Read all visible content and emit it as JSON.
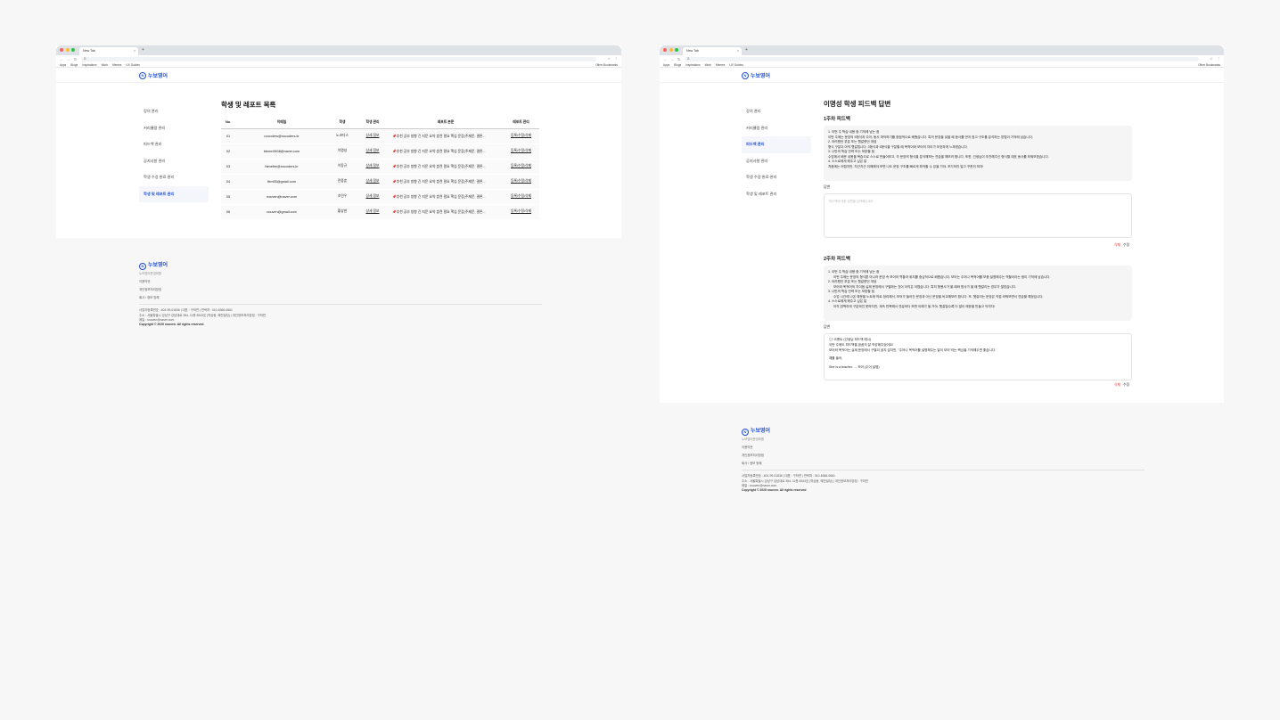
{
  "browser": {
    "tab_title": "New Tab",
    "tab_close": "×",
    "new_tab": "+",
    "omnibox": "G",
    "bookmarks": [
      "Apps",
      "Blogs",
      "Inspirations",
      "Work",
      "Memes",
      "UX Guides"
    ],
    "other_bookmarks": "Other Bookmarks"
  },
  "brand": {
    "logo": "누보영어",
    "logo_mark": "N"
  },
  "sidebar": {
    "items": [
      "강의 관리",
      "커리큘럼 관리",
      "피드백 관리",
      "공지사항 관리",
      "학생 수강 완료 관리",
      "학생 및 레포트 관리"
    ]
  },
  "left_page": {
    "title": "학생 및 레포트 목록",
    "columns": [
      "No.",
      "이메일",
      "학생",
      "학생 관리",
      "레포트 본문",
      "레포트 관리"
    ],
    "rows": [
      {
        "no": "01",
        "email": "nocoders@nocoders.kr",
        "name": "노코더스",
        "manage": "상세 정보",
        "preview": "추천 공부 방향 긴 지문 요약 훈련 필요 핵심 문장(주제문, 결론...",
        "actions": "등록/수정/삭제"
      },
      {
        "no": "02",
        "email": "bbmm9508@naver.com",
        "name": "이명성",
        "manage": "상세 정보",
        "preview": "추천 공부 방향 긴 지문 요약 훈련 필요 핵심 문장(주제문, 결론...",
        "actions": "등록/수정/삭제"
      },
      {
        "no": "03",
        "email": "famelee@nocoders.kr",
        "name": "이동규",
        "manage": "상세 정보",
        "preview": "추천 공부 방향 긴 지문 요약 훈련 필요 핵심 문장(주제문, 결론...",
        "actions": "등록/수정/삭제"
      },
      {
        "no": "04",
        "email": "ffrm55@gmail.com",
        "name": "전중훈",
        "manage": "상세 정보",
        "preview": "추천 공부 방향 긴 지문 요약 훈련 필요 핵심 문장(주제문, 결론...",
        "actions": "등록/수정/삭제"
      },
      {
        "no": "05",
        "email": "nouven@naver.com",
        "name": "조민우",
        "manage": "상세 정보",
        "preview": "추천 공부 방향 긴 지문 요약 훈련 필요 핵심 문장(주제문, 결론...",
        "actions": "등록/수정/삭제"
      },
      {
        "no": "06",
        "email": "nouven@gmail.com",
        "name": "황상현",
        "manage": "상세 정보",
        "preview": "추천 공부 방향 긴 지문 요약 훈련 필요 핵심 문장(주제문, 결론...",
        "actions": "등록/수정/삭제"
      }
    ]
  },
  "right_page": {
    "title": "이명성 학생 피드백 답변",
    "week1": {
      "title": "1주차 피드백",
      "lines": [
        "1. 이번 주 학습 내용 중 기억에 남는 점",
        "이번 주에는 문장의 5형식과 주어, 동사 파악하기를 중점적으로 배웠습니다. 특히 문장을 읽을 때 동사를 먼저 찾고 구조를 분석하는 방법이 기억에 남습니다.",
        "2. 어려웠던 부분 또는 헷갈렸던 개념",
        "형식 구분이 아직 헷갈립니다. 3형식과 5형식을 구분할 때 목적어와 보어의 차이가 모호하게 느껴졌습니다.",
        "3. 나만의 학습 전략 또는 보완할 점",
        "수업에서 배운 내용을 복습으로 스스로 만들어보고, 각 문장의 형식을 분석해보는 연습을 해보려 합니다. 또한, 선생님이 추천해주신 형식별 대표 동사를 외워보겠습니다.",
        "4. 스스로에게 해주고 싶은 말",
        "처음에는 어렵지만, 차근차근 이해해야 보면 나도 문장 구조를 빠르게 파악할 수 있을 거야. 포기하지 말고 꾸준히 하자!"
      ],
      "answer_label": "답변",
      "answer_placeholder": "피드백에 대한 답변을 입력해주세요",
      "delete": "삭제",
      "edit": "수정"
    },
    "week2": {
      "title": "2주차 피드백",
      "lines": [
        "1. 이번 주 학습 내용 중 기억에 남는 점",
        "이번 주에는 문장의 형식뿐 아니라 문장 속 보어의 역할과 위치를 중심적으로 배웠습니다. 보어는 주어나 목적어를 보충 설명해주는 역할이라는 점이 기억에 남습니다.",
        "2. 어려웠던 부분 또는 헷갈렸던 개념",
        "보어와 목적어의 차이점 실제 문장에서 구별하는 것이 아직은 어렵습니다. 특히 형용사가 올 때와 명사가 올 때 헷갈리는 경우가 많았습니다.",
        "3. 나만의 학습 전략 또는 보완할 점",
        "수업 시간에 나온 예문을 노트에 따로 정리해서, 보어가 들어간 문장과 아닌 문장을 비교해보려 합니다. 또, 헷갈리는 문장은 직접 바꿔보면서 연습할 예정입니다.",
        "4. 스스로에게 해주고 싶은 말",
        "아직 완벽하게 구분하진 못하지만, 계속 반복해서 연습하다 보면 이해가 될 거야. 헷갈릴수록 더 많이 예문을 만들고 익히자!"
      ],
      "answer_label": "답변",
      "answer_lines": [
        "💬 코멘트 (선생님 피드백 예시)",
        "이번 주에도 피드백을 꼼꼼히 잘 작성해주었어요!",
        "보어와 목적어는 실제 문장에서 구별이 쉽지 않지만, \"주어나 목적어를 설명해주는 말이 보어\"라는 핵심을 기억해두면 좋습니다.",
        "",
        "예를 들어,",
        "",
        "She is a teacher. → 보어 (주어 설명)"
      ],
      "delete": "삭제",
      "edit": "수정"
    }
  },
  "footer": {
    "subtitle": "누보영어운영위원",
    "nav": [
      "이용약관",
      "개인정보처리방침",
      "회사 / 정보 방해"
    ],
    "info": [
      "사업자등록번호 : 404-99-01836 | 대표 : 구하연 | 연락처 : 010-6366-0661",
      "주소 : 서울특별시 강남구 강남대로 354, 11층 8343호 (역삼동, 혜천빌딩) | 개인정보처리방침 : 구하연",
      "메일 : nouven@naver.com"
    ],
    "copyright": "Copyright © 2025 nouven. All rights reserved"
  }
}
